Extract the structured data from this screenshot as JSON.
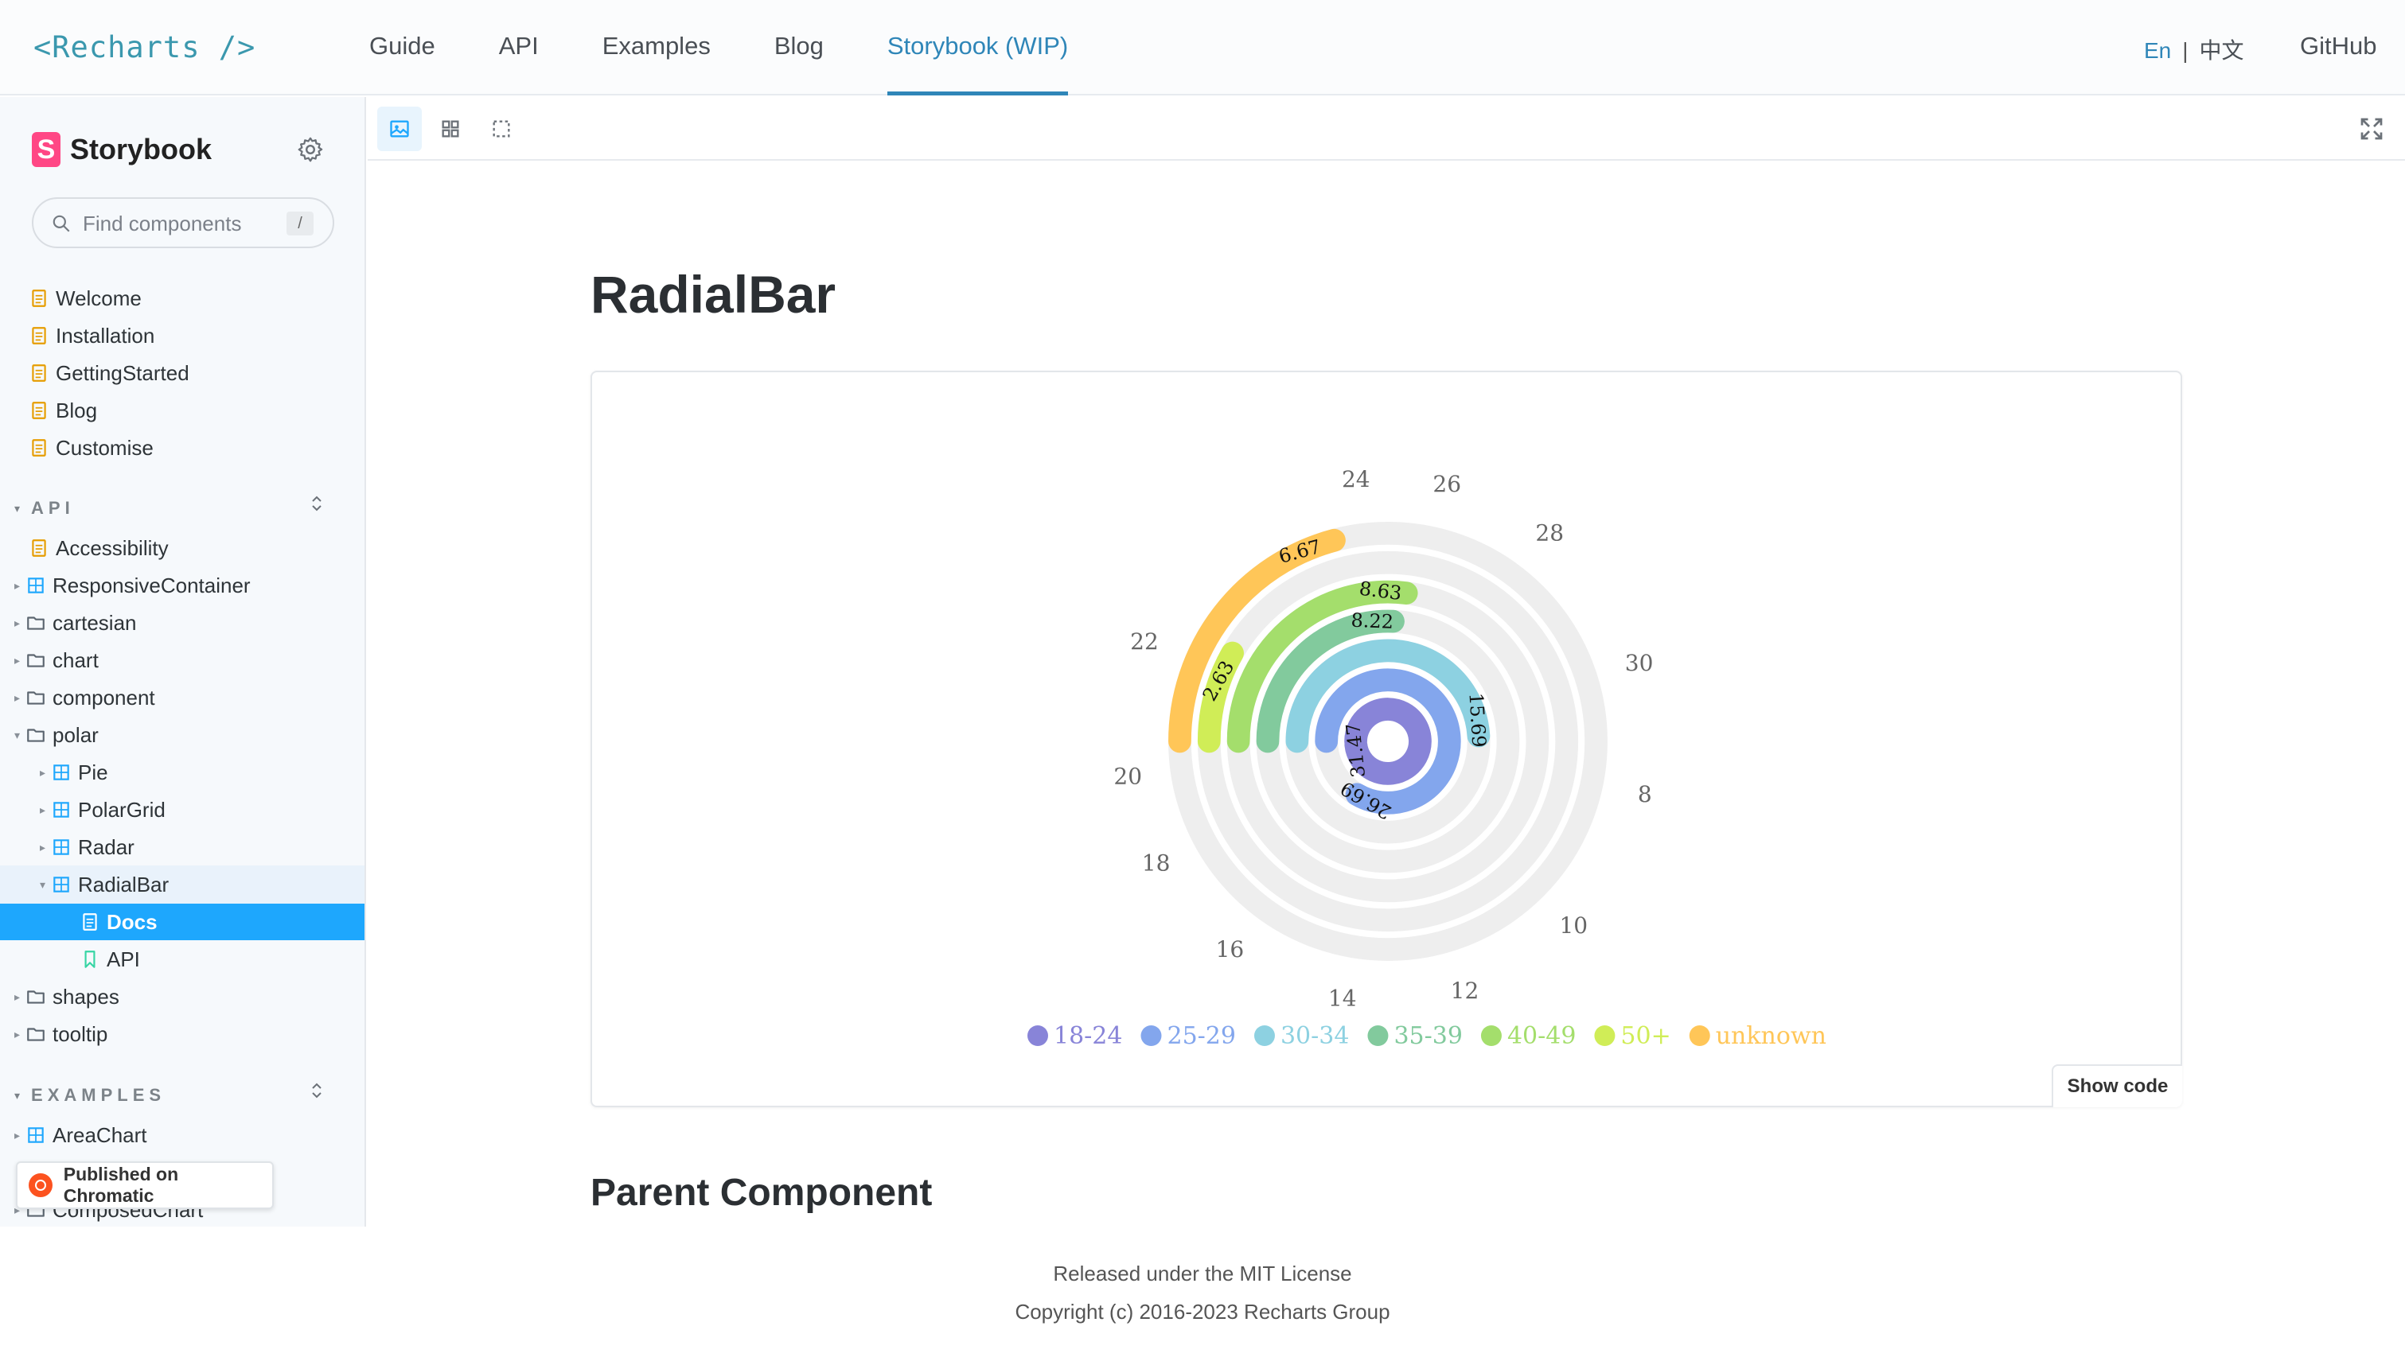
{
  "topnav": {
    "logo": "<Recharts />",
    "links": [
      "Guide",
      "API",
      "Examples",
      "Blog",
      "Storybook (WIP)"
    ],
    "active_link": "Storybook (WIP)",
    "lang_en": "En",
    "lang_separator": "|",
    "lang_zh": "中文",
    "github": "GitHub"
  },
  "sidebar": {
    "brand": "Storybook",
    "search": {
      "placeholder": "Find components",
      "shortcut": "/"
    },
    "docs": [
      "Welcome",
      "Installation",
      "GettingStarted",
      "Blog",
      "Customise"
    ],
    "api_section": "API",
    "api_items": [
      "Accessibility",
      "ResponsiveContainer",
      "cartesian",
      "chart",
      "component",
      "polar",
      "Pie",
      "PolarGrid",
      "Radar",
      "RadialBar",
      "Docs",
      "API",
      "shapes",
      "tooltip"
    ],
    "examples_section": "EXAMPLES",
    "examples_items": [
      "AreaChart",
      "ComposedChart"
    ],
    "chromatic": "Published on Chromatic"
  },
  "main": {
    "title": "RadialBar",
    "show_code": "Show code",
    "section_heading": "Parent Component"
  },
  "footer": {
    "line1": "Released under the MIT License",
    "line2": "Copyright (c) 2016-2023 Recharts Group"
  },
  "colors": {
    "accent": "#2f86b8",
    "selected": "#1ea7fd",
    "storybook_pink": "#ff4785"
  },
  "chart_data": {
    "type": "radialBar",
    "series": [
      {
        "name": "18-24",
        "value": 31.47,
        "label": "31.47",
        "color": "#8884d8"
      },
      {
        "name": "25-29",
        "value": 26.69,
        "label": "26.69",
        "color": "#83a6ed"
      },
      {
        "name": "30-34",
        "value": 15.69,
        "label": "15.69",
        "color": "#8dd1e1"
      },
      {
        "name": "35-39",
        "value": 8.22,
        "label": "8.22",
        "color": "#82ca9d"
      },
      {
        "name": "40-49",
        "value": 8.63,
        "label": "8.63",
        "color": "#a4de6c"
      },
      {
        "name": "50+",
        "value": 2.63,
        "label": "2.63",
        "color": "#d0ed57"
      },
      {
        "name": "unknown",
        "value": 6.67,
        "label": "6.67",
        "color": "#ffc658"
      }
    ],
    "angle_axis_ticks": [
      "24",
      "26",
      "28",
      "30",
      "8",
      "10",
      "12",
      "14",
      "16",
      "18",
      "20",
      "22"
    ],
    "legend_position": "bottom"
  }
}
